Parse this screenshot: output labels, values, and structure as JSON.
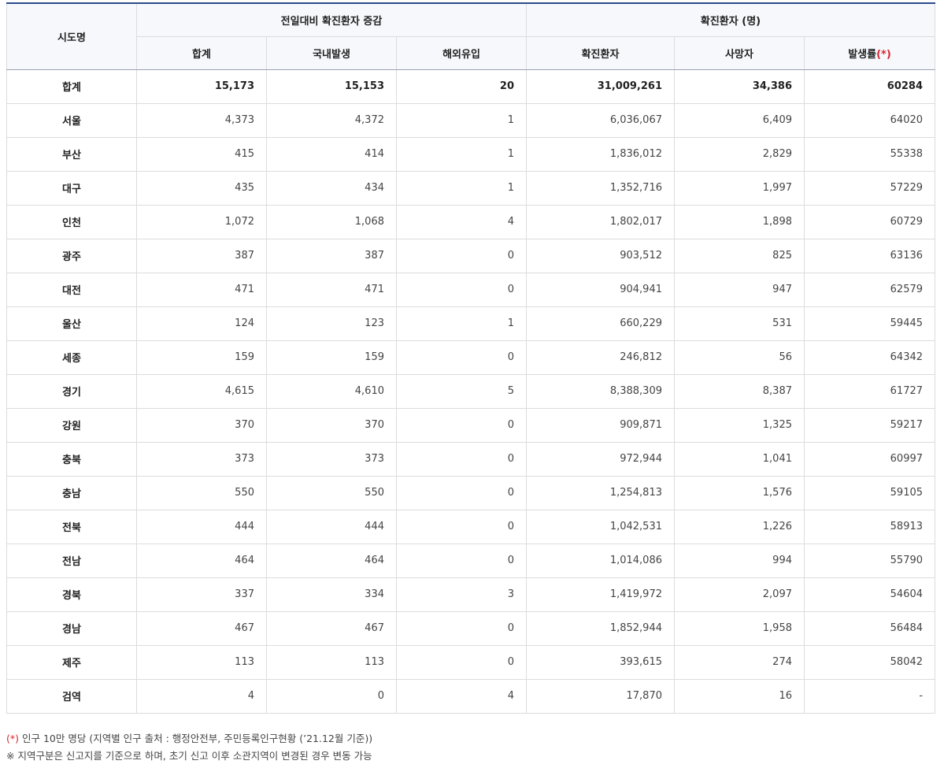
{
  "table": {
    "header": {
      "region": "시도명",
      "group1": "전일대비 확진환자 증감",
      "group2": "확진환자 (명)",
      "sub_total": "합계",
      "sub_domestic": "국내발생",
      "sub_overseas": "해외유입",
      "sub_confirmed": "확진환자",
      "sub_deaths": "사망자",
      "sub_rate": "발생률",
      "rate_mark": "(*)"
    },
    "rows": [
      {
        "region": "합계",
        "total": "15,173",
        "domestic": "15,153",
        "overseas": "20",
        "confirmed": "31,009,261",
        "deaths": "34,386",
        "rate": "60284"
      },
      {
        "region": "서울",
        "total": "4,373",
        "domestic": "4,372",
        "overseas": "1",
        "confirmed": "6,036,067",
        "deaths": "6,409",
        "rate": "64020"
      },
      {
        "region": "부산",
        "total": "415",
        "domestic": "414",
        "overseas": "1",
        "confirmed": "1,836,012",
        "deaths": "2,829",
        "rate": "55338"
      },
      {
        "region": "대구",
        "total": "435",
        "domestic": "434",
        "overseas": "1",
        "confirmed": "1,352,716",
        "deaths": "1,997",
        "rate": "57229"
      },
      {
        "region": "인천",
        "total": "1,072",
        "domestic": "1,068",
        "overseas": "4",
        "confirmed": "1,802,017",
        "deaths": "1,898",
        "rate": "60729"
      },
      {
        "region": "광주",
        "total": "387",
        "domestic": "387",
        "overseas": "0",
        "confirmed": "903,512",
        "deaths": "825",
        "rate": "63136"
      },
      {
        "region": "대전",
        "total": "471",
        "domestic": "471",
        "overseas": "0",
        "confirmed": "904,941",
        "deaths": "947",
        "rate": "62579"
      },
      {
        "region": "울산",
        "total": "124",
        "domestic": "123",
        "overseas": "1",
        "confirmed": "660,229",
        "deaths": "531",
        "rate": "59445"
      },
      {
        "region": "세종",
        "total": "159",
        "domestic": "159",
        "overseas": "0",
        "confirmed": "246,812",
        "deaths": "56",
        "rate": "64342"
      },
      {
        "region": "경기",
        "total": "4,615",
        "domestic": "4,610",
        "overseas": "5",
        "confirmed": "8,388,309",
        "deaths": "8,387",
        "rate": "61727"
      },
      {
        "region": "강원",
        "total": "370",
        "domestic": "370",
        "overseas": "0",
        "confirmed": "909,871",
        "deaths": "1,325",
        "rate": "59217"
      },
      {
        "region": "충북",
        "total": "373",
        "domestic": "373",
        "overseas": "0",
        "confirmed": "972,944",
        "deaths": "1,041",
        "rate": "60997"
      },
      {
        "region": "충남",
        "total": "550",
        "domestic": "550",
        "overseas": "0",
        "confirmed": "1,254,813",
        "deaths": "1,576",
        "rate": "59105"
      },
      {
        "region": "전북",
        "total": "444",
        "domestic": "444",
        "overseas": "0",
        "confirmed": "1,042,531",
        "deaths": "1,226",
        "rate": "58913"
      },
      {
        "region": "전남",
        "total": "464",
        "domestic": "464",
        "overseas": "0",
        "confirmed": "1,014,086",
        "deaths": "994",
        "rate": "55790"
      },
      {
        "region": "경북",
        "total": "337",
        "domestic": "334",
        "overseas": "3",
        "confirmed": "1,419,972",
        "deaths": "2,097",
        "rate": "54604"
      },
      {
        "region": "경남",
        "total": "467",
        "domestic": "467",
        "overseas": "0",
        "confirmed": "1,852,944",
        "deaths": "1,958",
        "rate": "56484"
      },
      {
        "region": "제주",
        "total": "113",
        "domestic": "113",
        "overseas": "0",
        "confirmed": "393,615",
        "deaths": "274",
        "rate": "58042"
      },
      {
        "region": "검역",
        "total": "4",
        "domestic": "0",
        "overseas": "4",
        "confirmed": "17,870",
        "deaths": "16",
        "rate": "-"
      }
    ]
  },
  "notes": {
    "note1_mark": "(*)",
    "note1_text": " 인구 10만 명당 (지역별 인구 출처 : 행정안전부, 주민등록인구현황 (’21.12월 기준))",
    "note2_text": "※ 지역구분은 신고지를 기준으로 하며, 초기 신고 이후 소관지역이 변경된 경우 변동 가능"
  },
  "colors": {
    "accent_border": "#2b4a8b",
    "header_bg": "#f6f8fc",
    "asterisk": "#d8242e"
  }
}
